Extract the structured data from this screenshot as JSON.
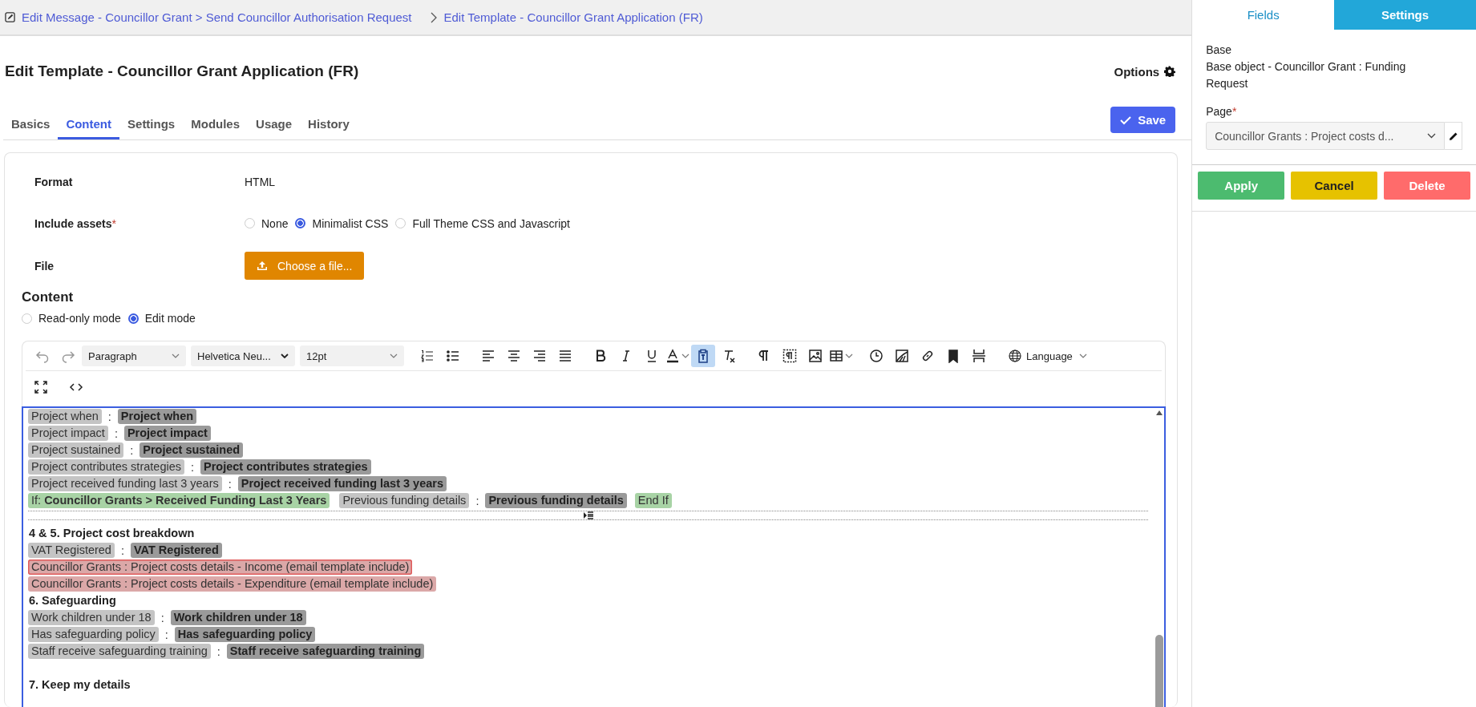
{
  "breadcrumb": [
    {
      "label": "Edit Message - Councillor Grant > Send Councillor Authorisation Request"
    },
    {
      "label": "Edit Template - Councillor Grant Application (FR)"
    }
  ],
  "page_title": "Edit Template - Councillor Grant Application (FR)",
  "options_label": "Options",
  "tabs": [
    {
      "label": "Basics",
      "selected": false
    },
    {
      "label": "Content",
      "selected": true
    },
    {
      "label": "Settings",
      "selected": false
    },
    {
      "label": "Modules",
      "selected": false
    },
    {
      "label": "Usage",
      "selected": false
    },
    {
      "label": "History",
      "selected": false
    }
  ],
  "save_label": "Save",
  "form": {
    "format_label": "Format",
    "format_value": "HTML",
    "assets_label": "Include assets",
    "assets_required_mark": "*",
    "assets_options": [
      {
        "label": "None",
        "selected": false
      },
      {
        "label": "Minimalist CSS",
        "selected": true
      },
      {
        "label": "Full Theme CSS and Javascript",
        "selected": false
      }
    ],
    "file_label": "File",
    "file_button": "Choose a file..."
  },
  "content_heading": "Content",
  "modes": [
    {
      "label": "Read-only mode",
      "selected": false
    },
    {
      "label": "Edit mode",
      "selected": true
    }
  ],
  "toolbar": {
    "rows": [
      [
        {
          "kind": "undo",
          "active": false,
          "disabled": true
        },
        {
          "kind": "redo",
          "active": false,
          "disabled": true
        },
        {
          "kind": "dropdown",
          "label": "Paragraph",
          "active": false,
          "disabled": false
        },
        {
          "kind": "dropdown",
          "label": "Helvetica Neu...",
          "active": false,
          "disabled": false
        },
        {
          "kind": "dropdown",
          "label": "12pt",
          "active": false,
          "disabled": false
        },
        {
          "kind": "numlist",
          "active": false,
          "disabled": false
        },
        {
          "kind": "bullist",
          "active": false,
          "disabled": false
        },
        {
          "kind": "alignleft",
          "active": false,
          "disabled": false
        },
        {
          "kind": "aligncenter",
          "active": false,
          "disabled": false
        },
        {
          "kind": "alignright",
          "active": false,
          "disabled": false
        },
        {
          "kind": "justify",
          "active": false,
          "disabled": false
        },
        {
          "kind": "bold",
          "active": false,
          "disabled": false
        },
        {
          "kind": "italic",
          "active": false,
          "disabled": false
        },
        {
          "kind": "underline",
          "active": false,
          "disabled": false
        },
        {
          "kind": "textcolor",
          "active": false,
          "disabled": false
        },
        {
          "kind": "paste",
          "active": true,
          "disabled": false
        },
        {
          "kind": "clearformat",
          "active": false,
          "disabled": false
        },
        {
          "kind": "pilcrow",
          "active": false,
          "disabled": false
        },
        {
          "kind": "pilcrowbox",
          "active": false,
          "disabled": false
        },
        {
          "kind": "image",
          "active": false,
          "disabled": false
        },
        {
          "kind": "table",
          "active": false,
          "disabled": false
        },
        {
          "kind": "clock",
          "active": false,
          "disabled": false
        },
        {
          "kind": "chart",
          "active": false,
          "disabled": false
        },
        {
          "kind": "link",
          "active": false,
          "disabled": false
        },
        {
          "kind": "bookmark",
          "active": false,
          "disabled": false
        },
        {
          "kind": "pagebreak",
          "active": false,
          "disabled": false
        },
        {
          "kind": "language",
          "label": "Language",
          "active": false,
          "disabled": false
        }
      ],
      [
        {
          "kind": "fullscreen",
          "active": false,
          "disabled": false
        },
        {
          "kind": "code",
          "active": false,
          "disabled": false
        }
      ]
    ]
  },
  "editor_lines": [
    {
      "kind": "fields",
      "segments": [
        {
          "kind": "label",
          "text": "Project when"
        },
        {
          "kind": "sep",
          "text": ":"
        },
        {
          "kind": "value",
          "text": "Project when"
        }
      ]
    },
    {
      "kind": "fields",
      "segments": [
        {
          "kind": "label",
          "text": "Project impact"
        },
        {
          "kind": "sep",
          "text": ":"
        },
        {
          "kind": "value",
          "text": "Project impact"
        }
      ]
    },
    {
      "kind": "fields",
      "segments": [
        {
          "kind": "label",
          "text": "Project sustained"
        },
        {
          "kind": "sep",
          "text": ":"
        },
        {
          "kind": "value",
          "text": "Project sustained"
        }
      ]
    },
    {
      "kind": "fields",
      "segments": [
        {
          "kind": "label",
          "text": "Project contributes strategies"
        },
        {
          "kind": "sep",
          "text": ":"
        },
        {
          "kind": "value",
          "text": "Project contributes strategies"
        }
      ]
    },
    {
      "kind": "fields",
      "segments": [
        {
          "kind": "label",
          "text": "Project received funding last 3 years"
        },
        {
          "kind": "sep",
          "text": ":"
        },
        {
          "kind": "value",
          "text": "Project received funding last 3 years"
        }
      ]
    },
    {
      "kind": "fields",
      "segments": [
        {
          "kind": "condition",
          "text": "If: **Councillor Grants > Received Funding Last 3 Years**"
        },
        {
          "kind": "label",
          "text": "Previous funding details"
        },
        {
          "kind": "sep",
          "text": ":"
        },
        {
          "kind": "value",
          "text": "Previous funding details"
        },
        {
          "kind": "endif",
          "text": "End If"
        }
      ]
    },
    {
      "kind": "pagebreak"
    },
    {
      "kind": "heading",
      "text": "4 & 5. Project cost breakdown"
    },
    {
      "kind": "fields",
      "segments": [
        {
          "kind": "label",
          "text": "VAT Registered"
        },
        {
          "kind": "sep",
          "text": ":"
        },
        {
          "kind": "value",
          "text": "VAT Registered"
        }
      ]
    },
    {
      "kind": "fields",
      "segments": [
        {
          "kind": "include",
          "text": "Councillor Grants : Project costs details - Income (email template include)",
          "selected": true
        }
      ]
    },
    {
      "kind": "fields",
      "segments": [
        {
          "kind": "include",
          "text": "Councillor Grants : Project costs details - Expenditure (email template include)",
          "selected": false
        }
      ]
    },
    {
      "kind": "heading",
      "text": "6. Safeguarding"
    },
    {
      "kind": "fields",
      "segments": [
        {
          "kind": "label",
          "text": "Work children under 18"
        },
        {
          "kind": "sep",
          "text": ":"
        },
        {
          "kind": "value",
          "text": "Work children under 18"
        }
      ]
    },
    {
      "kind": "fields",
      "segments": [
        {
          "kind": "label",
          "text": "Has safeguarding policy"
        },
        {
          "kind": "sep",
          "text": ":"
        },
        {
          "kind": "value",
          "text": "Has safeguarding policy"
        }
      ]
    },
    {
      "kind": "fields",
      "segments": [
        {
          "kind": "label",
          "text": "Staff receive safeguarding training"
        },
        {
          "kind": "sep",
          "text": ":"
        },
        {
          "kind": "value",
          "text": "Staff receive safeguarding training"
        }
      ]
    },
    {
      "kind": "blank"
    },
    {
      "kind": "heading",
      "text": "7. Keep my details"
    }
  ],
  "side_panel": {
    "tabs": [
      {
        "label": "Fields",
        "selected": true
      },
      {
        "label": "Settings",
        "selected": false
      }
    ],
    "base_label": "Base",
    "base_value": "Base object - Councillor Grant : Funding Request",
    "page_label": "Page",
    "page_required_mark": "*",
    "page_value": "Councillor Grants : Project costs d...",
    "buttons": [
      {
        "kind": "apply",
        "label": "Apply"
      },
      {
        "kind": "cancel",
        "label": "Cancel"
      },
      {
        "kind": "delete",
        "label": "Delete"
      }
    ]
  }
}
